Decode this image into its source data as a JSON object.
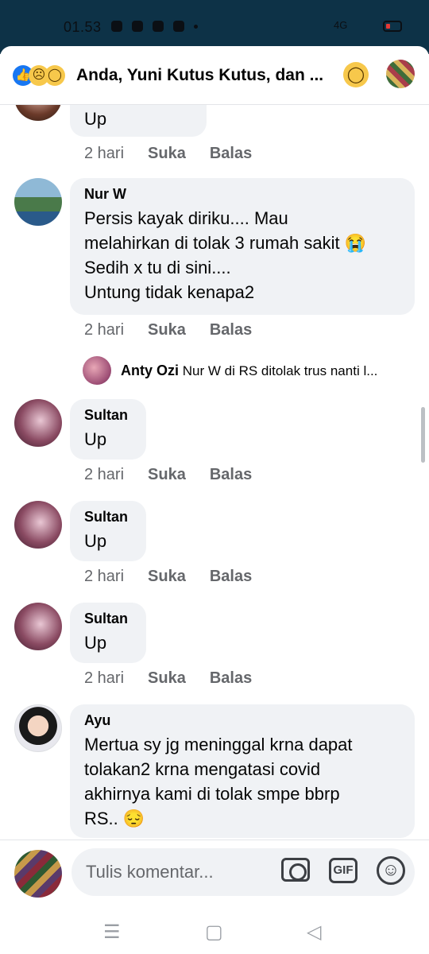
{
  "status_bar": {
    "time": "01.53",
    "network": "4G"
  },
  "header": {
    "title": "Anda, Yuni Kutus Kutus, dan ...",
    "reaction_icons": [
      "like-icon",
      "sad-icon",
      "wow-icon"
    ],
    "trailing_reaction": "wow-icon"
  },
  "comments": [
    {
      "author": "",
      "text": "Up",
      "time": "2 hari",
      "like": "Suka",
      "reply": "Balas"
    },
    {
      "author": "Nur W",
      "lines": [
        "Persis kayak diriku.... Mau",
        "melahirkan di tolak 3 rumah sakit 😭",
        "Sedih x tu di sini....",
        "Untung tidak kenapa2"
      ],
      "time": "2 hari",
      "like": "Suka",
      "reply": "Balas",
      "reply_preview": {
        "author": "Anty Ozi",
        "text": "Nur W di RS ditolak trus nanti l..."
      }
    },
    {
      "author": "Sultan",
      "text": "Up",
      "time": "2 hari",
      "like": "Suka",
      "reply": "Balas"
    },
    {
      "author": "Sultan",
      "text": "Up",
      "time": "2 hari",
      "like": "Suka",
      "reply": "Balas"
    },
    {
      "author": "Sultan",
      "text": "Up",
      "time": "2 hari",
      "like": "Suka",
      "reply": "Balas"
    },
    {
      "author": "Ayu",
      "lines": [
        "Mertua sy jg meninggal krna dapat",
        "tolakan2 krna mengatasi covid",
        "akhirnya kami di tolak smpe bbrp",
        "RS.. 😔"
      ]
    }
  ],
  "composer": {
    "placeholder": "Tulis komentar...",
    "gif_label": "GIF"
  },
  "colors": {
    "status_bar": "#0d3247",
    "bubble": "#f0f2f5",
    "meta_text": "#65676b",
    "brand": "#1877f2"
  }
}
